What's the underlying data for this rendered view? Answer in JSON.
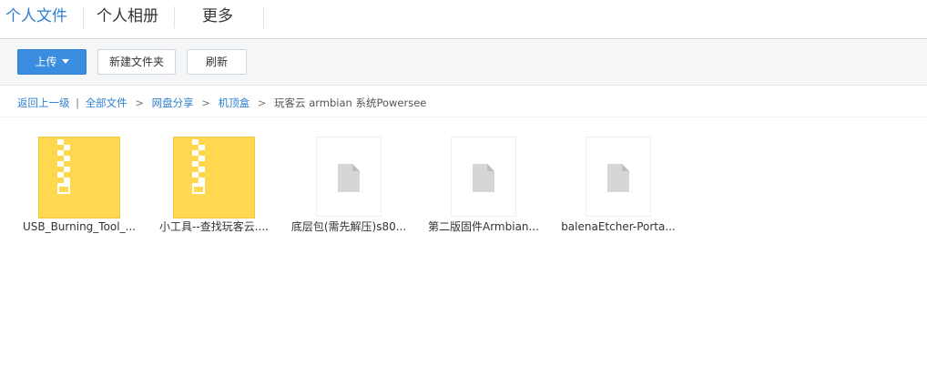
{
  "nav": {
    "tabs": [
      {
        "label": "个人文件",
        "active": true
      },
      {
        "label": "个人相册",
        "active": false
      },
      {
        "label": "更多",
        "active": false
      }
    ]
  },
  "toolbar": {
    "upload_label": "上传",
    "new_folder_label": "新建文件夹",
    "refresh_label": "刷新"
  },
  "breadcrumb": {
    "back_label": "返回上一级",
    "bar_separator": "|",
    "separator": ">",
    "items": [
      "全部文件",
      "网盘分享",
      "机顶盒"
    ],
    "current": "玩客云 armbian 系统Powersee"
  },
  "files": [
    {
      "name": "USB_Burning_Tool_...",
      "icon": "zip-file-icon"
    },
    {
      "name": "小工具--查找玩客云....",
      "icon": "zip-file-icon"
    },
    {
      "name": "底层包(需先解压)s80...",
      "icon": "generic-file-icon"
    },
    {
      "name": "第二版固件Armbian...",
      "icon": "generic-file-icon"
    },
    {
      "name": "balenaEtcher-Porta...",
      "icon": "generic-file-icon"
    }
  ],
  "colors": {
    "accent": "#2e7fd0",
    "primary_button": "#3b8de0",
    "zip_yellow": "#ffd84f",
    "toolbar_bg": "#f4f6f8"
  }
}
